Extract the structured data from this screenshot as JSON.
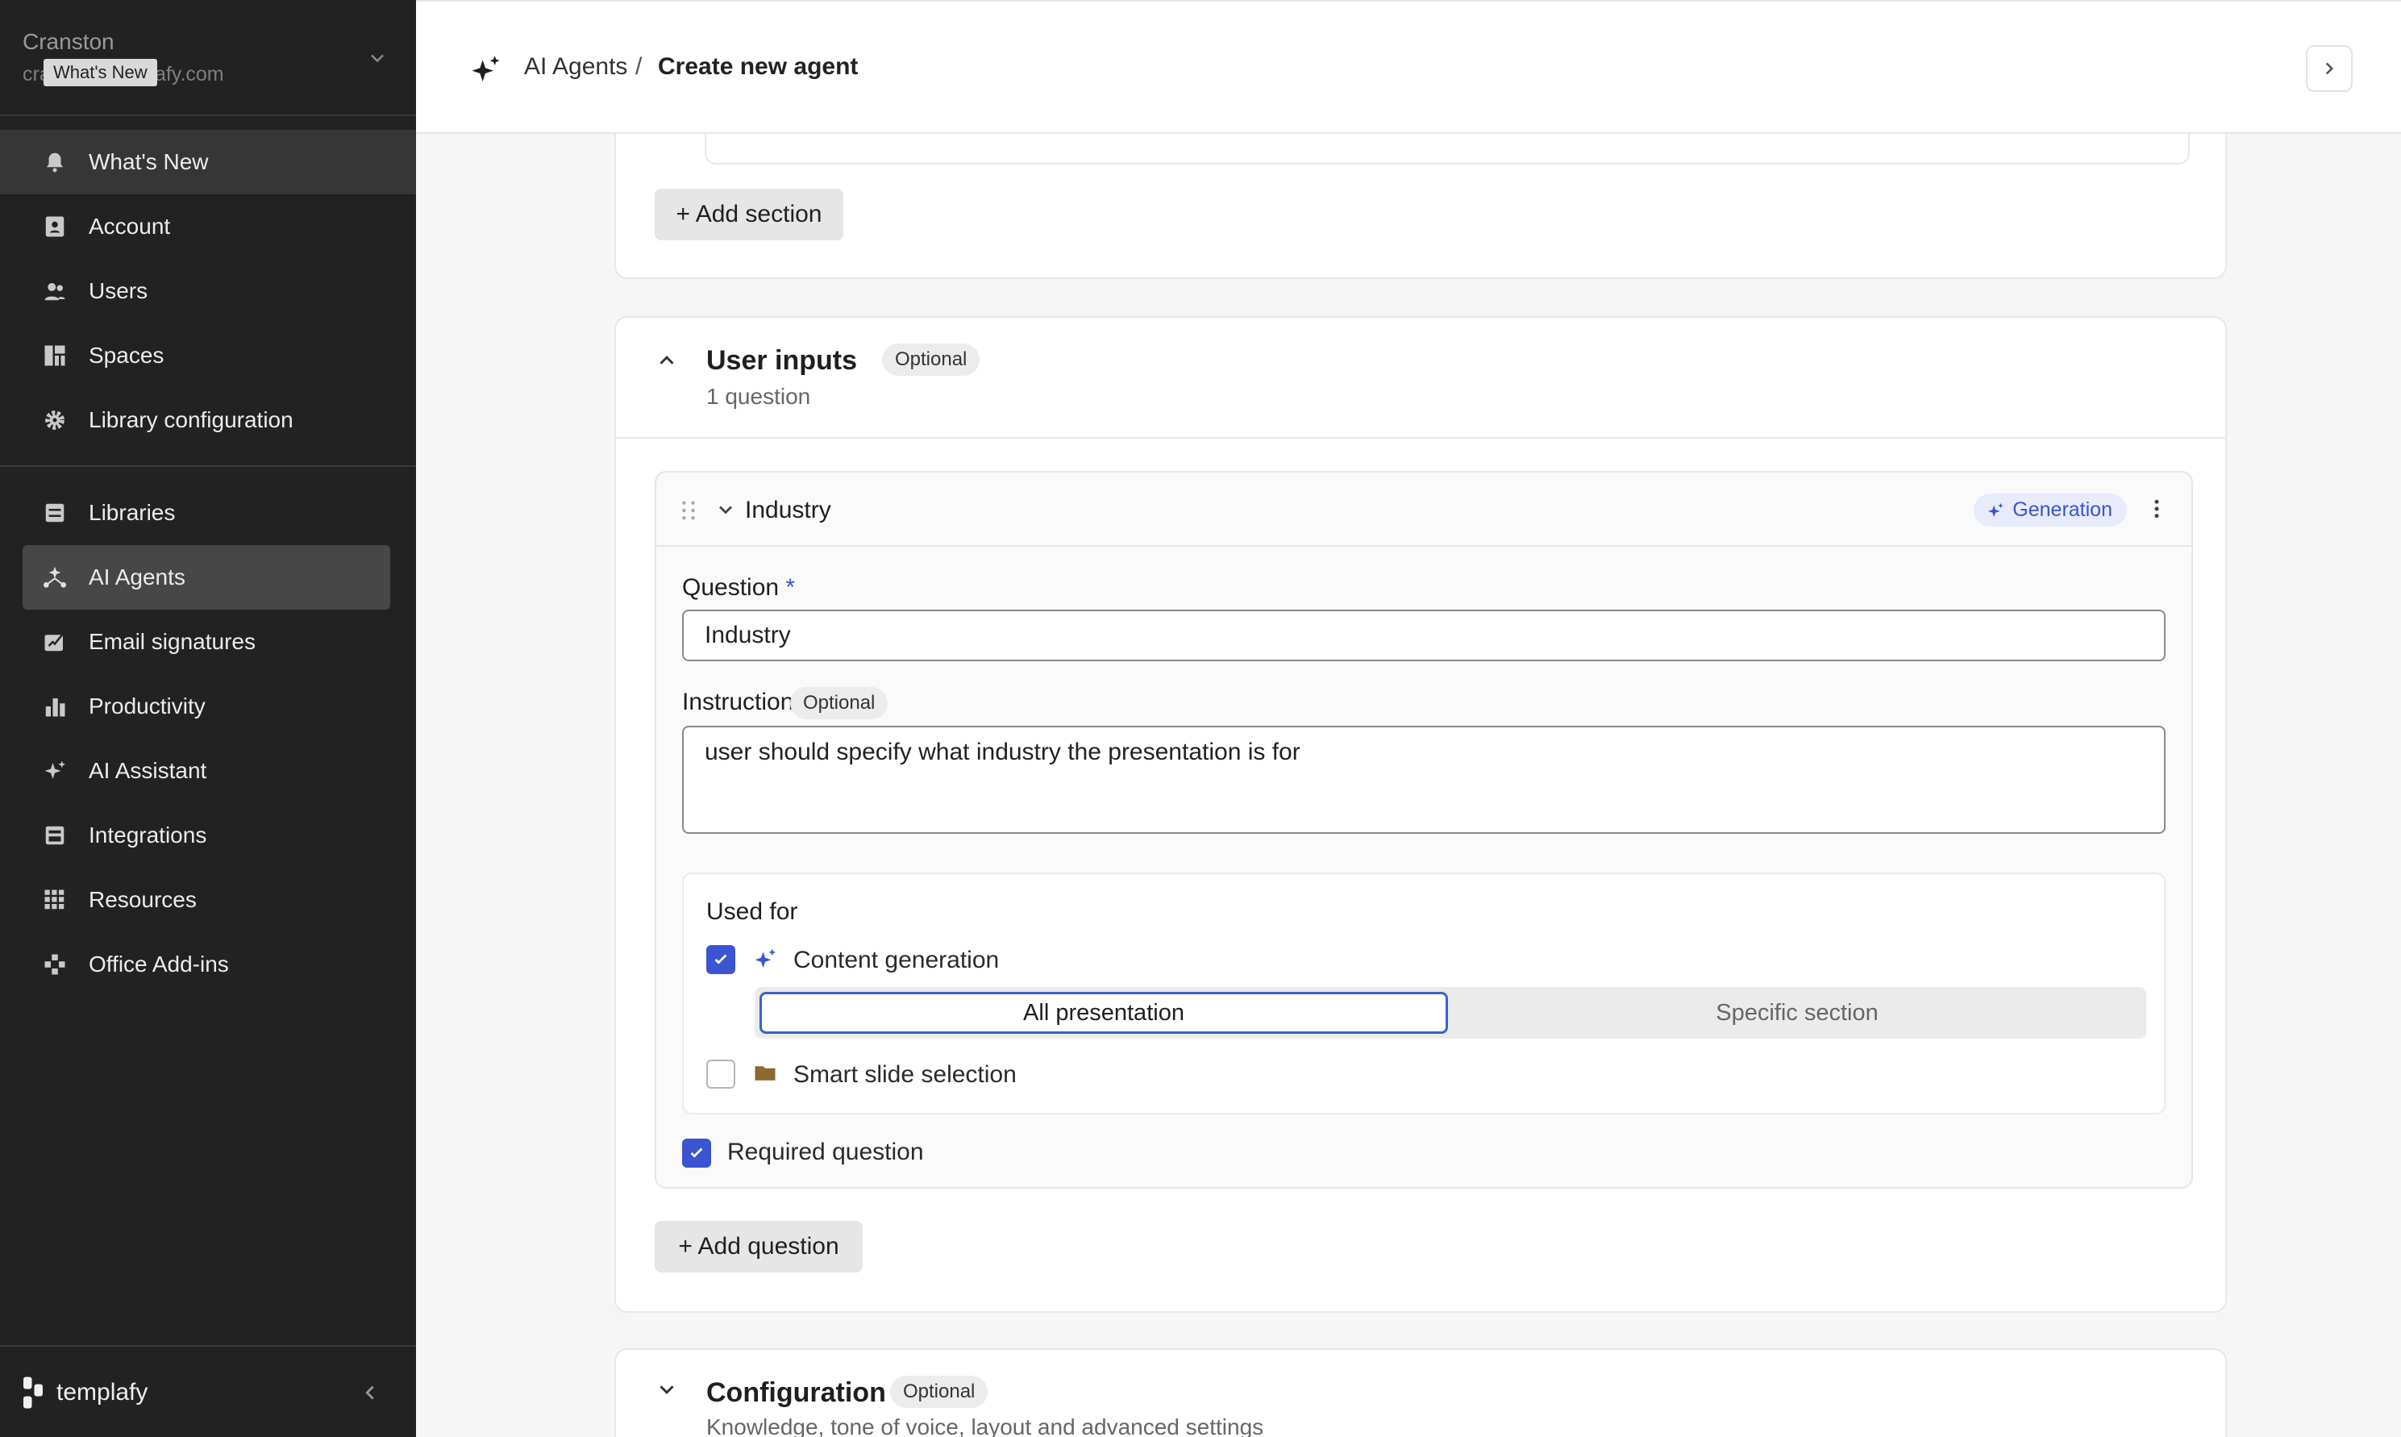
{
  "sidebar": {
    "tenant_name": "Cranston",
    "tenant_domain": "cranston.templafy.com",
    "tooltip": "What's New",
    "items": [
      {
        "label": "What's New",
        "icon": "bell-icon"
      },
      {
        "label": "Account",
        "icon": "account-icon"
      },
      {
        "label": "Users",
        "icon": "users-icon"
      },
      {
        "label": "Spaces",
        "icon": "spaces-icon"
      },
      {
        "label": "Library configuration",
        "icon": "gear-icon"
      },
      {
        "label": "Libraries",
        "icon": "libraries-icon"
      },
      {
        "label": "AI Agents",
        "icon": "agents-icon"
      },
      {
        "label": "Email signatures",
        "icon": "signature-icon"
      },
      {
        "label": "Productivity",
        "icon": "productivity-icon"
      },
      {
        "label": "AI Assistant",
        "icon": "sparkle-icon"
      },
      {
        "label": "Integrations",
        "icon": "integrations-icon"
      },
      {
        "label": "Resources",
        "icon": "resources-icon"
      },
      {
        "label": "Office Add-ins",
        "icon": "addins-icon"
      }
    ],
    "brand": "templafy"
  },
  "header": {
    "breadcrumb_parent": "AI Agents",
    "breadcrumb_separator": "/",
    "breadcrumb_current": "Create new agent"
  },
  "sections_card": {
    "add_section_label": "+ Add section"
  },
  "user_inputs": {
    "title": "User inputs",
    "badge": "Optional",
    "count": "1 question",
    "question_card": {
      "title": "Industry",
      "badge": "Generation",
      "question_label": "Question",
      "required_mark": "*",
      "question_value": "Industry",
      "instructions_label": "Instructions",
      "instructions_badge": "Optional",
      "instructions_value": "user should specify what industry the presentation is for",
      "used_for_label": "Used for",
      "content_generation_label": "Content generation",
      "content_generation_checked": true,
      "scope_options": [
        "All presentation",
        "Specific section"
      ],
      "scope_selected": "All presentation",
      "smart_slide_label": "Smart slide selection",
      "smart_slide_checked": false,
      "required_label": "Required question",
      "required_checked": true
    },
    "add_question_label": "+ Add question"
  },
  "configuration": {
    "title": "Configuration",
    "badge": "Optional",
    "description": "Knowledge, tone of voice, layout and advanced settings"
  },
  "colors": {
    "sidebar_bg": "#222222",
    "accent_blue": "#3b54d1",
    "folder_brown": "#8a6a2f"
  }
}
